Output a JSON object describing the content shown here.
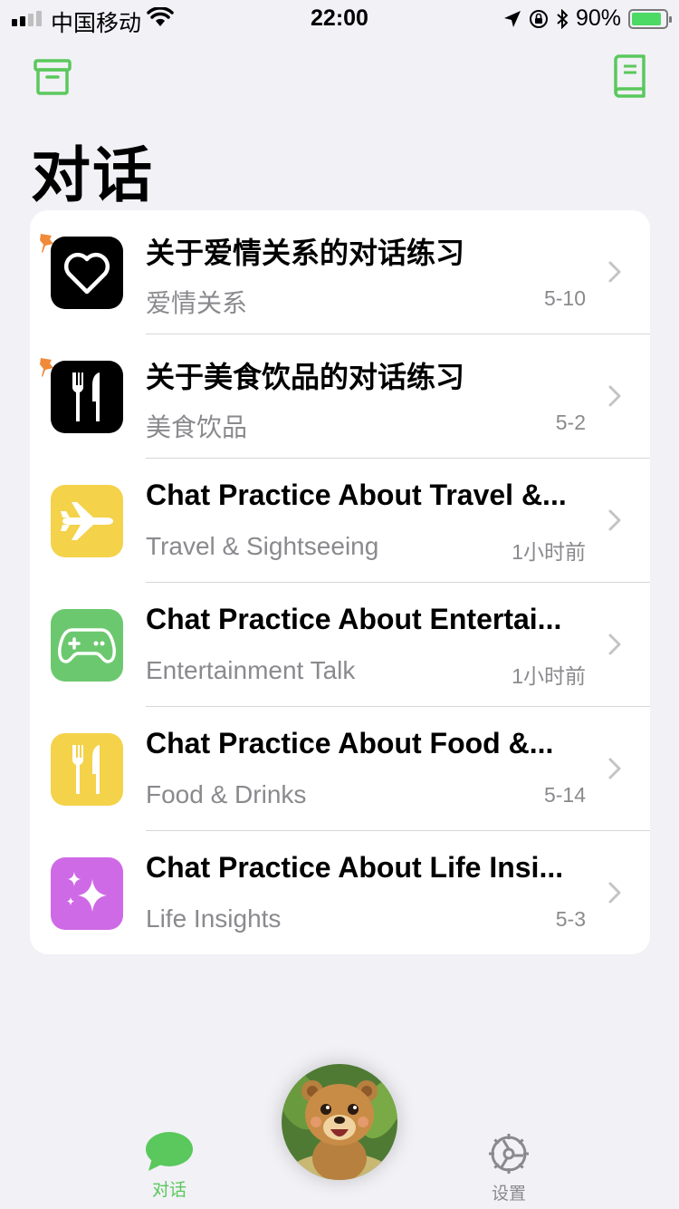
{
  "status": {
    "carrier": "中国移动",
    "time": "22:00",
    "battery": "90%"
  },
  "header": {
    "title": "对话",
    "left_icon": "archive-icon",
    "right_icon": "book-icon"
  },
  "conversations": [
    {
      "title": "关于爱情关系的对话练习",
      "subtitle": "爱情关系",
      "time": "5-10",
      "icon": "heart-icon",
      "icon_bg": "#000000",
      "pinned": true
    },
    {
      "title": "关于美食饮品的对话练习",
      "subtitle": "美食饮品",
      "time": "5-2",
      "icon": "fork-knife-icon",
      "icon_bg": "#000000",
      "pinned": true
    },
    {
      "title": "Chat Practice About Travel &...",
      "subtitle": "Travel & Sightseeing",
      "time": "1小时前",
      "icon": "airplane-icon",
      "icon_bg": "#f4d24a",
      "pinned": false
    },
    {
      "title": "Chat Practice About Entertai...",
      "subtitle": "Entertainment Talk",
      "time": "1小时前",
      "icon": "gamepad-icon",
      "icon_bg": "#6cc86f",
      "pinned": false
    },
    {
      "title": "Chat Practice About Food &...",
      "subtitle": "Food & Drinks",
      "time": "5-14",
      "icon": "fork-knife-icon",
      "icon_bg": "#f4d24a",
      "pinned": false
    },
    {
      "title": "Chat Practice About Life Insi...",
      "subtitle": "Life Insights",
      "time": "5-3",
      "icon": "sparkles-icon",
      "icon_bg": "#cf6ae6",
      "pinned": false
    }
  ],
  "tabs": {
    "chat": {
      "label": "对话",
      "icon": "chat-bubble-icon",
      "color": "#5ac85c"
    },
    "center": {
      "icon": "bear-avatar"
    },
    "settings": {
      "label": "设置",
      "icon": "gear-icon",
      "color": "#8a8a8e"
    }
  },
  "colors": {
    "accent": "#5ac85c",
    "background": "#f1f1f6"
  }
}
